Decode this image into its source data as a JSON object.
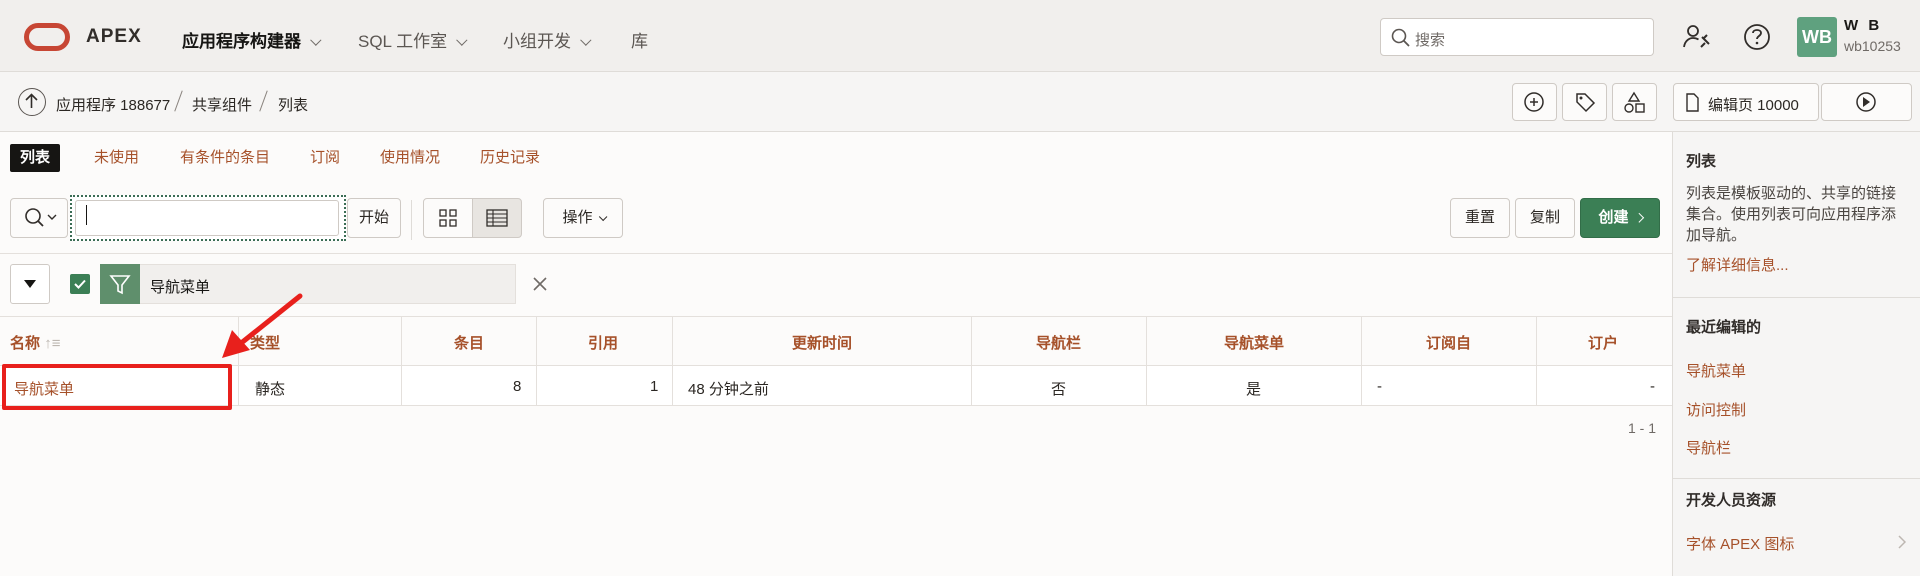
{
  "header": {
    "brand": "APEX",
    "nav": [
      {
        "label": "应用程序构建器",
        "dropdown": true
      },
      {
        "label": "SQL 工作室",
        "dropdown": true
      },
      {
        "label": "小组开发",
        "dropdown": true
      },
      {
        "label": "库",
        "dropdown": false
      }
    ],
    "search_placeholder": "搜索",
    "user_initials": "WB",
    "user_name": "W B",
    "user_id": "wb10253"
  },
  "breadcrumb": {
    "items": [
      "应用程序 188677",
      "共享组件",
      "列表"
    ],
    "edit_page_label": "编辑页 10000"
  },
  "tabs": [
    "列表",
    "未使用",
    "有条件的条目",
    "订阅",
    "使用情况",
    "历史记录"
  ],
  "toolbar": {
    "search_value": "",
    "go_label": "开始",
    "actions_label": "操作",
    "reset_label": "重置",
    "copy_label": "复制",
    "create_label": "创建"
  },
  "filter": {
    "label": "导航菜单"
  },
  "table": {
    "columns": [
      "名称",
      "类型",
      "条目",
      "引用",
      "更新时间",
      "导航栏",
      "导航菜单",
      "订阅自",
      "订户"
    ],
    "rows": [
      [
        "导航菜单",
        "静态",
        "8",
        "1",
        "48 分钟之前",
        "否",
        "是",
        "-",
        "-"
      ]
    ],
    "pagination": "1 - 1"
  },
  "side_panel": {
    "title": "列表",
    "description": "列表是模板驱动的、共享的链接集合。使用列表可向应用程序添加导航。",
    "learn_more": "了解详细信息...",
    "recent_title": "最近编辑的",
    "recent_items": [
      "导航菜单",
      "访问控制",
      "导航栏"
    ],
    "resources_title": "开发人员资源",
    "resources_items": [
      "字体 APEX 图标"
    ]
  },
  "colors": {
    "accent_link": "#a6512a",
    "primary_button": "#3b7f55",
    "annotation_red": "#e8201c"
  }
}
